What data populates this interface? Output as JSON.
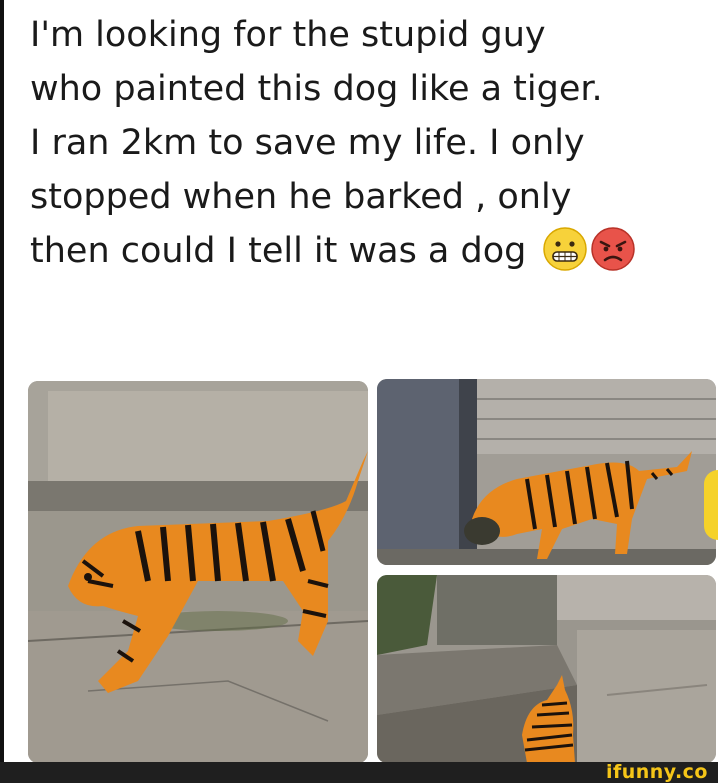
{
  "caption": {
    "lines": [
      "I'm looking for the stupid guy",
      "who painted this dog like a tiger.",
      "I ran 2km to save my life. I only",
      "stopped when he barked , only",
      "then could I tell it was a dog"
    ],
    "emojis": [
      "grimacing-face-icon",
      "angry-face-icon"
    ]
  },
  "photos": [
    {
      "name": "dog-painted-tiger-photo-main"
    },
    {
      "name": "dog-painted-tiger-photo-top-right"
    },
    {
      "name": "dog-painted-tiger-photo-bottom-right"
    }
  ],
  "watermark": {
    "text": "ifunny.co"
  },
  "colors": {
    "tiger_orange": "#e8891f",
    "stripe": "#1b120c",
    "brand": "#f5c518"
  }
}
